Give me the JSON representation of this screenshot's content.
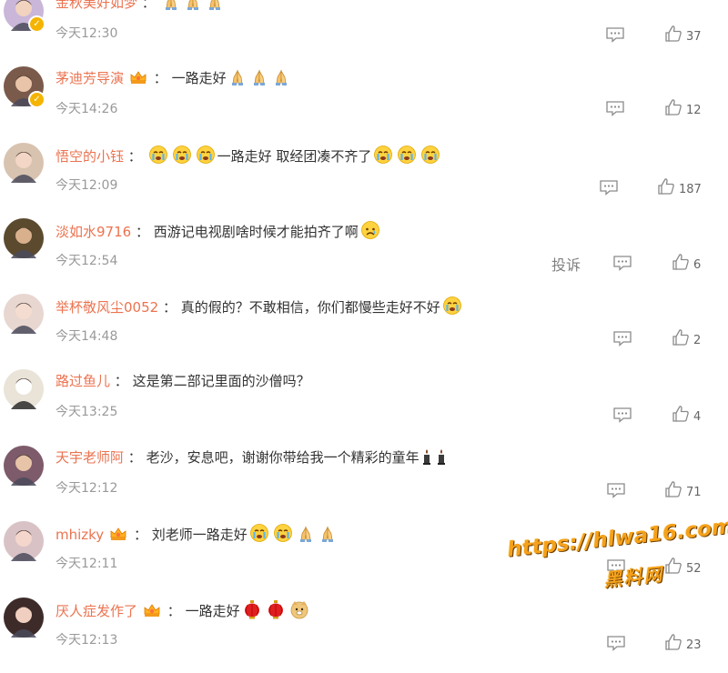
{
  "comments": [
    {
      "username": "金秋美好如梦",
      "badge": "none",
      "text": "",
      "emojis": [
        "pray",
        "pray",
        "pray"
      ],
      "time": "今天12:30",
      "likes": "37",
      "report": "",
      "verified": true,
      "avatar_color": "#c9b6d9"
    },
    {
      "username": "茅迪芳导演",
      "badge": "crown",
      "text": "一路走好",
      "emojis_after": [
        "pray",
        "pray",
        "pray"
      ],
      "time": "今天14:26",
      "likes": "12",
      "report": "",
      "verified": true,
      "avatar_color": "#7a5a4a"
    },
    {
      "username": "悟空的小钰",
      "badge": "none",
      "text": "一路走好 取经团凑不齐了",
      "emojis_before": [
        "cry",
        "cry",
        "cry"
      ],
      "emojis_after": [
        "cry",
        "cry",
        "cry"
      ],
      "time": "今天12:09",
      "likes": "187",
      "report": "",
      "verified": false,
      "avatar_color": "#d8c3b0"
    },
    {
      "username": "淡如水9716",
      "badge": "none",
      "text": "西游记电视剧啥时候才能拍齐了啊",
      "emojis_after": [
        "sad"
      ],
      "time": "今天12:54",
      "likes": "6",
      "report": "投诉",
      "verified": false,
      "avatar_color": "#5b4a2e"
    },
    {
      "username": "举杯敬风尘0052",
      "badge": "none",
      "text": "真的假的？不敢相信，你们都慢些走好不好",
      "emojis_after": [
        "cry"
      ],
      "time": "今天14:48",
      "likes": "2",
      "report": "",
      "verified": false,
      "avatar_color": "#e8d6d0"
    },
    {
      "username": "路过鱼儿",
      "badge": "none",
      "text": "这是第二部记里面的沙僧吗？",
      "emojis_after": [],
      "time": "今天13:25",
      "likes": "4",
      "report": "",
      "verified": false,
      "avatar_color": "#e9e3d8"
    },
    {
      "username": "天宇老师阿",
      "badge": "none",
      "text": "老沙，安息吧，谢谢你带给我一个精彩的童年",
      "emojis_after": [
        "candle",
        "candle"
      ],
      "time": "今天12:12",
      "likes": "71",
      "report": "",
      "verified": false,
      "avatar_color": "#7d5b6a"
    },
    {
      "username": "mhizky",
      "badge": "crown",
      "text": "刘老师一路走好",
      "emojis_after": [
        "cry",
        "cry",
        "pray",
        "pray"
      ],
      "time": "今天12:11",
      "likes": "52",
      "report": "",
      "verified": false,
      "avatar_color": "#d9c2c6"
    },
    {
      "username": "厌人症发作了",
      "badge": "crown",
      "text": "一路走好",
      "emojis_after": [
        "lantern",
        "lantern",
        "doge"
      ],
      "time": "今天12:13",
      "likes": "23",
      "report": "",
      "verified": false,
      "avatar_color": "#3d2b2a"
    }
  ],
  "watermark": {
    "url": "https://hlwa16.com",
    "name": "黑料网"
  },
  "colors": {
    "username": "#eb7350",
    "time": "#999999",
    "text": "#333333"
  }
}
